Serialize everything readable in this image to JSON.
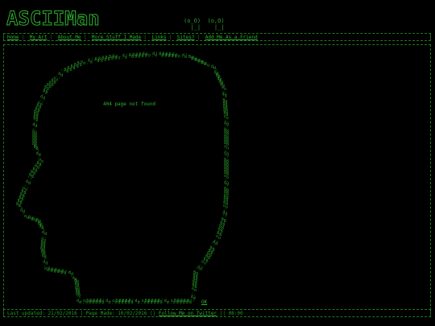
{
  "logo": {
    "main": "ASCIIMan",
    "suffix": ""
  },
  "eyes": "(o_O)  (o,O)\n  |_|    |_|",
  "nav": [
    {
      "label": "Home"
    },
    {
      "label": "My Art"
    },
    {
      "label": "About Me"
    },
    {
      "label": "More Stuff I Made"
    },
    {
      "label": "Links"
    },
    {
      "label": "Sites?"
    },
    {
      "label": "Add Me As a Friend"
    }
  ],
  "message": "404 page not found",
  "ok_link": "OK",
  "footer": {
    "last_updated": "Last updated: 21/02/2016",
    "page_made": "Page Made: 10/02/2016",
    "follow": "Follow Me on Twitter",
    "time": "08:00"
  }
}
